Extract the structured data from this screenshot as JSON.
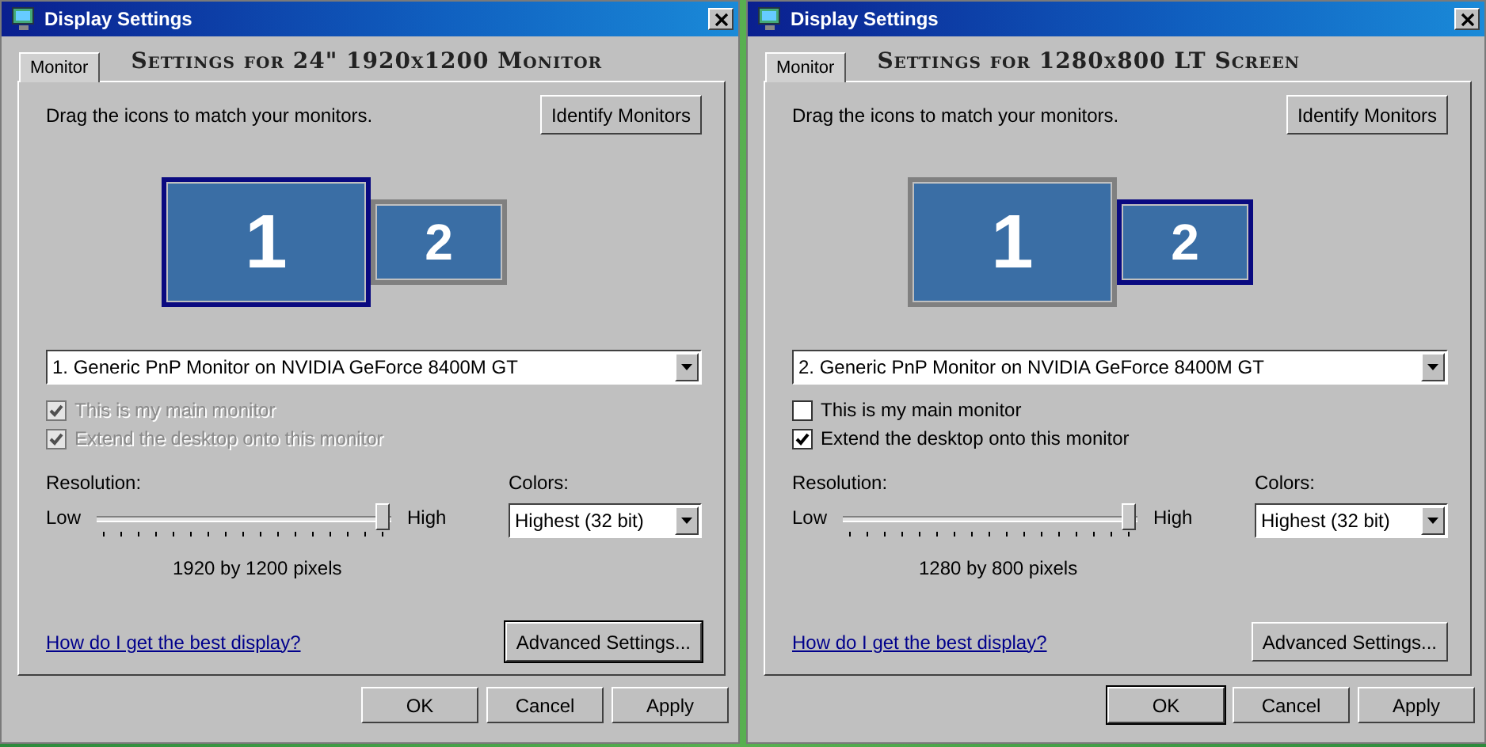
{
  "windows": [
    {
      "title": "Display Settings",
      "tab": {
        "label": "Monitor",
        "selected": true
      },
      "heading": "Settings for 24\" 1920x1200 Monitor",
      "instruction": "Drag the icons to match your monitors.",
      "identify_button": "Identify Monitors",
      "monitors": [
        {
          "label": "1",
          "kind": "large",
          "selected": true
        },
        {
          "label": "2",
          "kind": "small",
          "selected": false
        }
      ],
      "monitor_dropdown": "1. Generic PnP Monitor on NVIDIA GeForce 8400M GT",
      "checkboxes": [
        {
          "label": "This is my main monitor",
          "checked": true,
          "disabled": true
        },
        {
          "label": "Extend the desktop onto this monitor",
          "checked": true,
          "disabled": true
        }
      ],
      "resolution": {
        "label": "Resolution:",
        "low": "Low",
        "high": "High",
        "level": 1,
        "reading": "1920 by 1200 pixels"
      },
      "colors": {
        "label": "Colors:",
        "value": "Highest (32 bit)"
      },
      "help_link": "How do I get the best display?",
      "advanced_button": {
        "label": "Advanced Settings...",
        "focused": true
      },
      "buttons": [
        {
          "label": "OK",
          "focused": false
        },
        {
          "label": "Cancel",
          "focused": false
        },
        {
          "label": "Apply",
          "focused": false
        }
      ]
    },
    {
      "title": "Display Settings",
      "tab": {
        "label": "Monitor",
        "selected": true
      },
      "heading": "Settings for 1280x800 LT Screen",
      "instruction": "Drag the icons to match your monitors.",
      "identify_button": "Identify Monitors",
      "monitors": [
        {
          "label": "1",
          "kind": "large",
          "selected": false
        },
        {
          "label": "2",
          "kind": "small",
          "selected": true
        }
      ],
      "monitor_dropdown": "2. Generic PnP Monitor on NVIDIA GeForce 8400M GT",
      "checkboxes": [
        {
          "label": "This is my main monitor",
          "checked": false,
          "disabled": false
        },
        {
          "label": "Extend the desktop onto this monitor",
          "checked": true,
          "disabled": false
        }
      ],
      "resolution": {
        "label": "Resolution:",
        "low": "Low",
        "high": "High",
        "level": 1,
        "reading": "1280 by 800 pixels"
      },
      "colors": {
        "label": "Colors:",
        "value": "Highest (32 bit)"
      },
      "help_link": "How do I get the best display?",
      "advanced_button": {
        "label": "Advanced Settings...",
        "focused": false
      },
      "buttons": [
        {
          "label": "OK",
          "focused": true
        },
        {
          "label": "Cancel",
          "focused": false
        },
        {
          "label": "Apply",
          "focused": false
        }
      ]
    }
  ]
}
